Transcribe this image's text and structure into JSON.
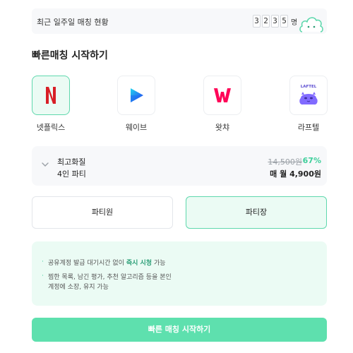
{
  "stats": {
    "label": "최근 일주일 매칭 현황",
    "digits": [
      "3",
      "2",
      "3",
      "5"
    ],
    "unit": "명"
  },
  "section_title": "빠른매칭 시작하기",
  "services": [
    {
      "name": "넷플릭스",
      "icon": "netflix-logo-icon",
      "color": "#d81f26",
      "selected": true
    },
    {
      "name": "웨이브",
      "icon": "wavve-logo-icon",
      "color": "#1d6cf2",
      "selected": false
    },
    {
      "name": "왓챠",
      "icon": "watcha-logo-icon",
      "color": "#ff0558",
      "selected": false
    },
    {
      "name": "라프텔",
      "icon": "laftel-logo-icon",
      "logo_text": "LAFTEL",
      "color": "#816bff",
      "selected": false
    }
  ],
  "plan": {
    "quality": "최고화질",
    "party_size": "4인 파티",
    "original_price": "14,500원",
    "discount": "67%",
    "price": "매 월 4,900원"
  },
  "roles": {
    "member": "파티원",
    "leader": "파티장",
    "selected": "leader"
  },
  "info": {
    "bullet": "·",
    "line1_pre": "공유계정 발급 대기시간 없이 ",
    "line1_bold": "즉시 시청",
    "line1_post": " 가능",
    "line2a": "찜한 목록, 남긴 평가, 추천 알고리즘 등을 본인",
    "line2b": "계정에 소장, 유지 가능"
  },
  "cta_label": "빠른 매칭 시작하기",
  "colors": {
    "accent": "#5ee0ae",
    "accent_light": "#ebfbf4",
    "discount": "#3ecf9b"
  }
}
